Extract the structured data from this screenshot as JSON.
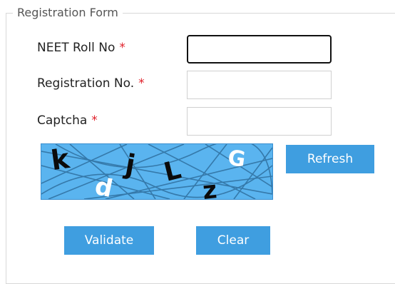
{
  "form": {
    "legend": "Registration Form",
    "required_marker": "*",
    "fields": {
      "roll_no": {
        "label": "NEET Roll No",
        "value": ""
      },
      "registration_no": {
        "label": "Registration No.",
        "value": ""
      },
      "captcha": {
        "label": "Captcha",
        "value": ""
      }
    },
    "captcha_image": {
      "text": "kdjLzG",
      "chars": [
        "k",
        "d",
        "j",
        "L",
        "z",
        "G"
      ],
      "background_color": "#5ab4ef"
    },
    "buttons": {
      "refresh": "Refresh",
      "validate": "Validate",
      "clear": "Clear"
    },
    "colors": {
      "button": "#3f9ee0",
      "required": "#e0202a"
    }
  }
}
